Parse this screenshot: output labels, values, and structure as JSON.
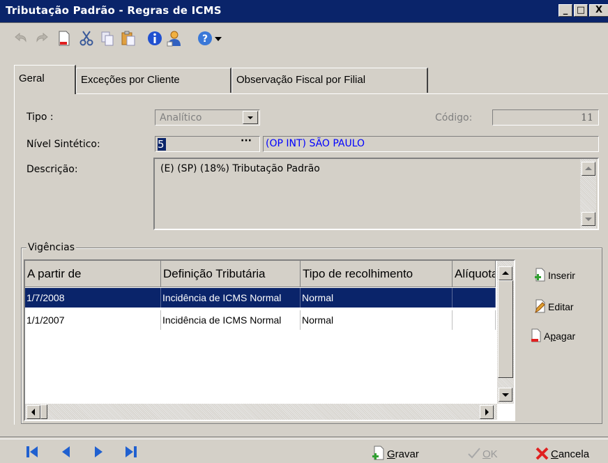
{
  "window": {
    "title": "Tributação Padrão - Regras de ICMS",
    "min_label": "_",
    "max_label": "□",
    "close_label": "X"
  },
  "toolbar": {
    "icons": [
      "undo-icon",
      "redo-icon",
      "new-icon",
      "cut-icon",
      "copy-icon",
      "paste-icon",
      "info-icon",
      "user-icon",
      "help-icon",
      "dropdown-arrow-icon"
    ]
  },
  "tabs": [
    {
      "label": "Geral",
      "active": true
    },
    {
      "label": "Exceções por Cliente",
      "active": false
    },
    {
      "label": "Observação Fiscal por Filial",
      "active": false
    }
  ],
  "form": {
    "tipo_label": "Tipo :",
    "tipo_value": "Analítico",
    "codigo_label": "Código:",
    "codigo_value": "11",
    "nivel_label": "Nível Sintético:",
    "nivel_value": "5",
    "nivel_button": "···",
    "nivel_desc": "(OP INT) SÃO PAULO",
    "descricao_label": "Descrição:",
    "descricao_value": "(E) (SP) (18%) Tributação Padrão"
  },
  "vigencias": {
    "legend": "Vigências",
    "columns": [
      "A partir de",
      "Definição Tributária",
      "Tipo de recolhimento",
      "Alíquota"
    ],
    "rows": [
      {
        "data": "1/7/2008",
        "definicao": "Incidência de ICMS Normal",
        "tipo": "Normal",
        "aliquota": "",
        "selected": true
      },
      {
        "data": "1/1/2007",
        "definicao": "Incidência de ICMS Normal",
        "tipo": "Normal",
        "aliquota": "",
        "selected": false
      }
    ],
    "buttons": {
      "inserir": "Inserir",
      "editar": "Editar",
      "apagar_pre": "A",
      "apagar_u": "p",
      "apagar_post": "agar"
    }
  },
  "footer": {
    "gravar_u": "G",
    "gravar_rest": "ravar",
    "ok_u": "O",
    "ok_rest": "K",
    "cancela_u": "C",
    "cancela_rest": "ancela"
  },
  "colors": {
    "title_bar": "#0a246a",
    "selection": "#0a246a",
    "link_text": "#0000ff",
    "face": "#d4d0c8"
  }
}
